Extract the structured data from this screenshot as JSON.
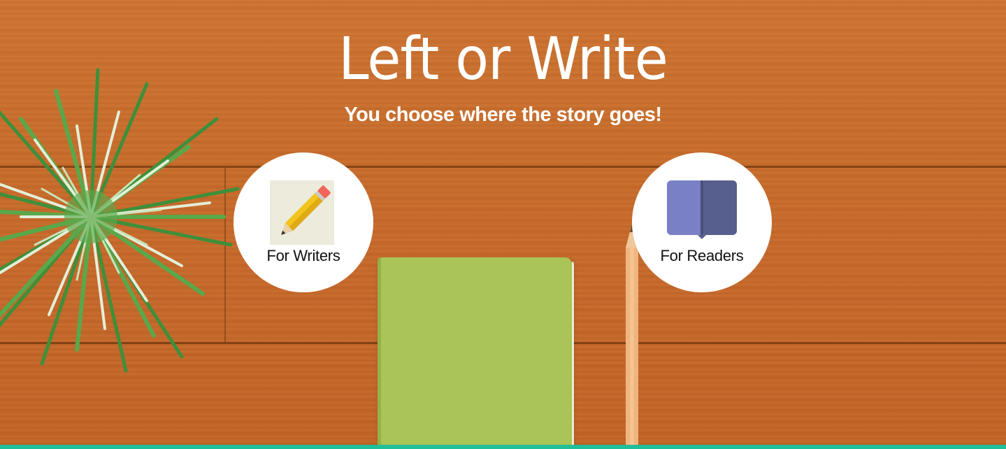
{
  "hero": {
    "title": "Left or Write",
    "subtitle": "You choose where the story goes!"
  },
  "choices": [
    {
      "label": "For Writers",
      "icon": "pencil-icon"
    },
    {
      "label": "For Readers",
      "icon": "open-book-icon"
    }
  ],
  "colors": {
    "wood": "#c76a28",
    "notebook": "#a9c457",
    "accent_bar": "#1fbf9a",
    "book_left": "#7a80c6",
    "book_right": "#575f8f",
    "pencil_paper_bg": "#ecebdc"
  }
}
